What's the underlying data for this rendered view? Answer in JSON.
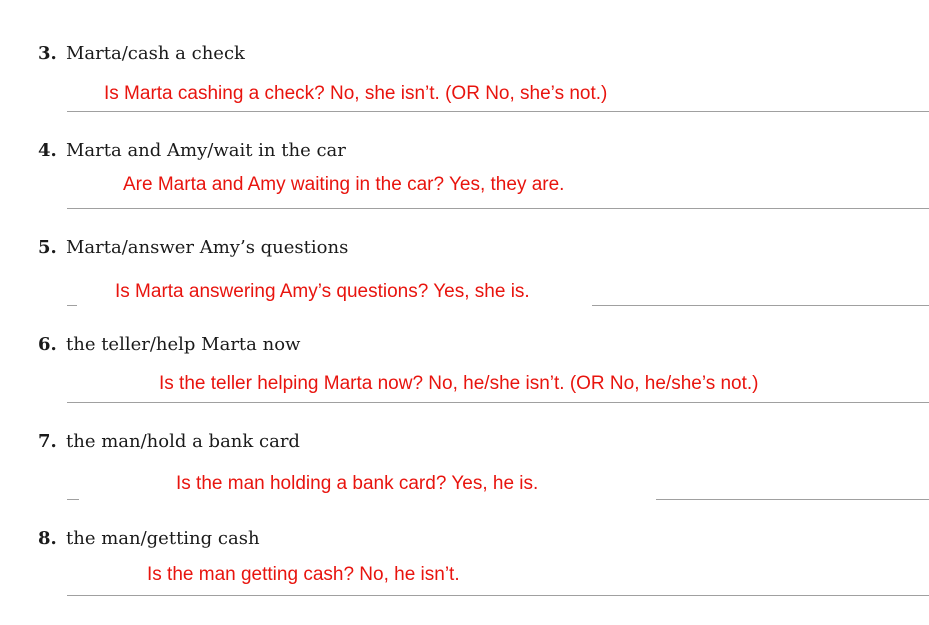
{
  "exercise": {
    "items": [
      {
        "number": "3.",
        "prompt": "Marta/cash a check",
        "answer": "Is Marta cashing a check? No, she isn’t. (OR No, she’s not.)"
      },
      {
        "number": "4.",
        "prompt": "Marta and Amy/wait in the car",
        "answer": "Are Marta and Amy waiting in the car? Yes, they are."
      },
      {
        "number": "5.",
        "prompt": "Marta/answer Amy’s questions",
        "answer": "Is Marta answering Amy’s questions? Yes, she is."
      },
      {
        "number": "6.",
        "prompt": "the teller/help Marta now",
        "answer": "Is the teller helping Marta now? No, he/she isn’t. (OR No, he/she’s not.)"
      },
      {
        "number": "7.",
        "prompt": "the man/hold a bank card",
        "answer": "Is the man holding a bank card? Yes, he is."
      },
      {
        "number": "8.",
        "prompt": "the man/getting cash",
        "answer": "Is the man getting cash? No, he isn’t."
      }
    ]
  }
}
